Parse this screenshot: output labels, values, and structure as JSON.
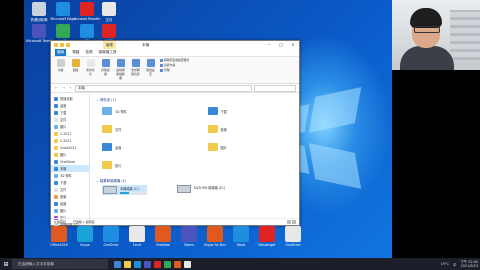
{
  "window": {
    "path": "本機",
    "tools_tag": "管理",
    "menu": [
      "檔案",
      "電腦",
      "檢視",
      "磁碟機工具"
    ],
    "ribbon": [
      "內容",
      "開啟",
      "重新命名",
      "存取媒體",
      "連線網路磁碟機",
      "新增網路位置",
      "開啟設定"
    ],
    "ribbon_group": [
      "解除安裝或變更程式",
      "系統內容",
      "管理"
    ]
  },
  "nav": [
    {
      "label": "快速存取",
      "color": "#3a86d8"
    },
    {
      "label": "桌面",
      "color": "#3a86d8"
    },
    {
      "label": "下載",
      "color": "#3a86d8"
    },
    {
      "label": "文件",
      "color": "#e0e0e0"
    },
    {
      "label": "圖片",
      "color": "#6bb0e6"
    },
    {
      "label": "C-2021",
      "color": "#f2c94c"
    },
    {
      "label": "C-2021",
      "color": "#f2c94c"
    },
    {
      "label": "Class2021",
      "color": "#f2c94c"
    },
    {
      "label": "圖片",
      "color": "#f2c94c"
    },
    {
      "label": "OneDrive",
      "color": "#3a86d8"
    },
    {
      "label": "本機",
      "color": "#3a86d8"
    },
    {
      "label": "3D 物件",
      "color": "#6bb0e6"
    },
    {
      "label": "下載",
      "color": "#3a86d8"
    },
    {
      "label": "文件",
      "color": "#e0e0e0"
    },
    {
      "label": "音樂",
      "color": "#f2994a"
    },
    {
      "label": "桌面",
      "color": "#3a86d8"
    },
    {
      "label": "圖片",
      "color": "#6bb0e6"
    },
    {
      "label": "影片",
      "color": "#9b51e0"
    },
    {
      "label": "本機磁碟 (C:)",
      "color": "#c9d3dc"
    },
    {
      "label": "網路",
      "color": "#3a86d8"
    }
  ],
  "content": {
    "folders_header": "資料夾 (7)",
    "folders": [
      {
        "label": "3D 物件",
        "kind": "pic"
      },
      {
        "label": "下載",
        "kind": "dl"
      },
      {
        "label": "文件",
        "kind": "plain"
      },
      {
        "label": "音樂",
        "kind": "plain"
      },
      {
        "label": "桌面",
        "kind": "blue"
      },
      {
        "label": "圖片",
        "kind": "plain"
      },
      {
        "label": "影片",
        "kind": "plain"
      }
    ],
    "drives_header": "裝置和磁碟機 (2)",
    "drives": [
      {
        "label": "本機磁碟 (C:)",
        "used": 0.35
      },
      {
        "label": "DVD RW 磁碟機 (D:)",
        "used": 0
      }
    ]
  },
  "status": {
    "count": "9 個項目",
    "selected": "已選取 1 個項目"
  },
  "desktop_icons": [
    {
      "label": "資源回收筒",
      "color": "#c9d3dc"
    },
    {
      "label": "Microsoft Edge",
      "color": "#1f8ee0"
    },
    {
      "label": "Acrobat Reader",
      "color": "#e02424"
    },
    {
      "label": "文件",
      "color": "#e8e8e8"
    },
    {
      "label": "Microsoft Teams",
      "color": "#4b53bc"
    },
    {
      "label": "Google Chrome",
      "color": "#34a853"
    },
    {
      "label": "CM",
      "color": "#1f8ee0"
    },
    {
      "label": "WPS",
      "color": "#e02424"
    }
  ],
  "pinned": [
    {
      "label": "Office2016",
      "color": "#e05a1f"
    },
    {
      "label": "Skype",
      "color": "#1ca0d8"
    },
    {
      "label": "OneDrive",
      "color": "#1f8ee0"
    },
    {
      "label": "Excel",
      "color": "#e8e8e8"
    },
    {
      "label": "OneNote",
      "color": "#e05a1f"
    },
    {
      "label": "Teams",
      "color": "#4b53bc"
    },
    {
      "label": "Skype for Business",
      "color": "#e05a1f"
    },
    {
      "label": "Word",
      "color": "#1f8ee0"
    },
    {
      "label": "Messenger",
      "color": "#e02424"
    },
    {
      "label": "OneDrive",
      "color": "#e8e8e8"
    }
  ],
  "taskbar": {
    "start": "⊞",
    "search_placeholder": "在這裡輸入文字來搜尋",
    "apps": [
      "#3a86d8",
      "#f2c94c",
      "#1f8ee0",
      "#4b53bc",
      "#e02424",
      "#34a853",
      "#e05a1f",
      "#e8e8e8"
    ],
    "weather": "19°C",
    "lang": "中",
    "time": "下午 02:00",
    "date": "2021/9/23"
  }
}
